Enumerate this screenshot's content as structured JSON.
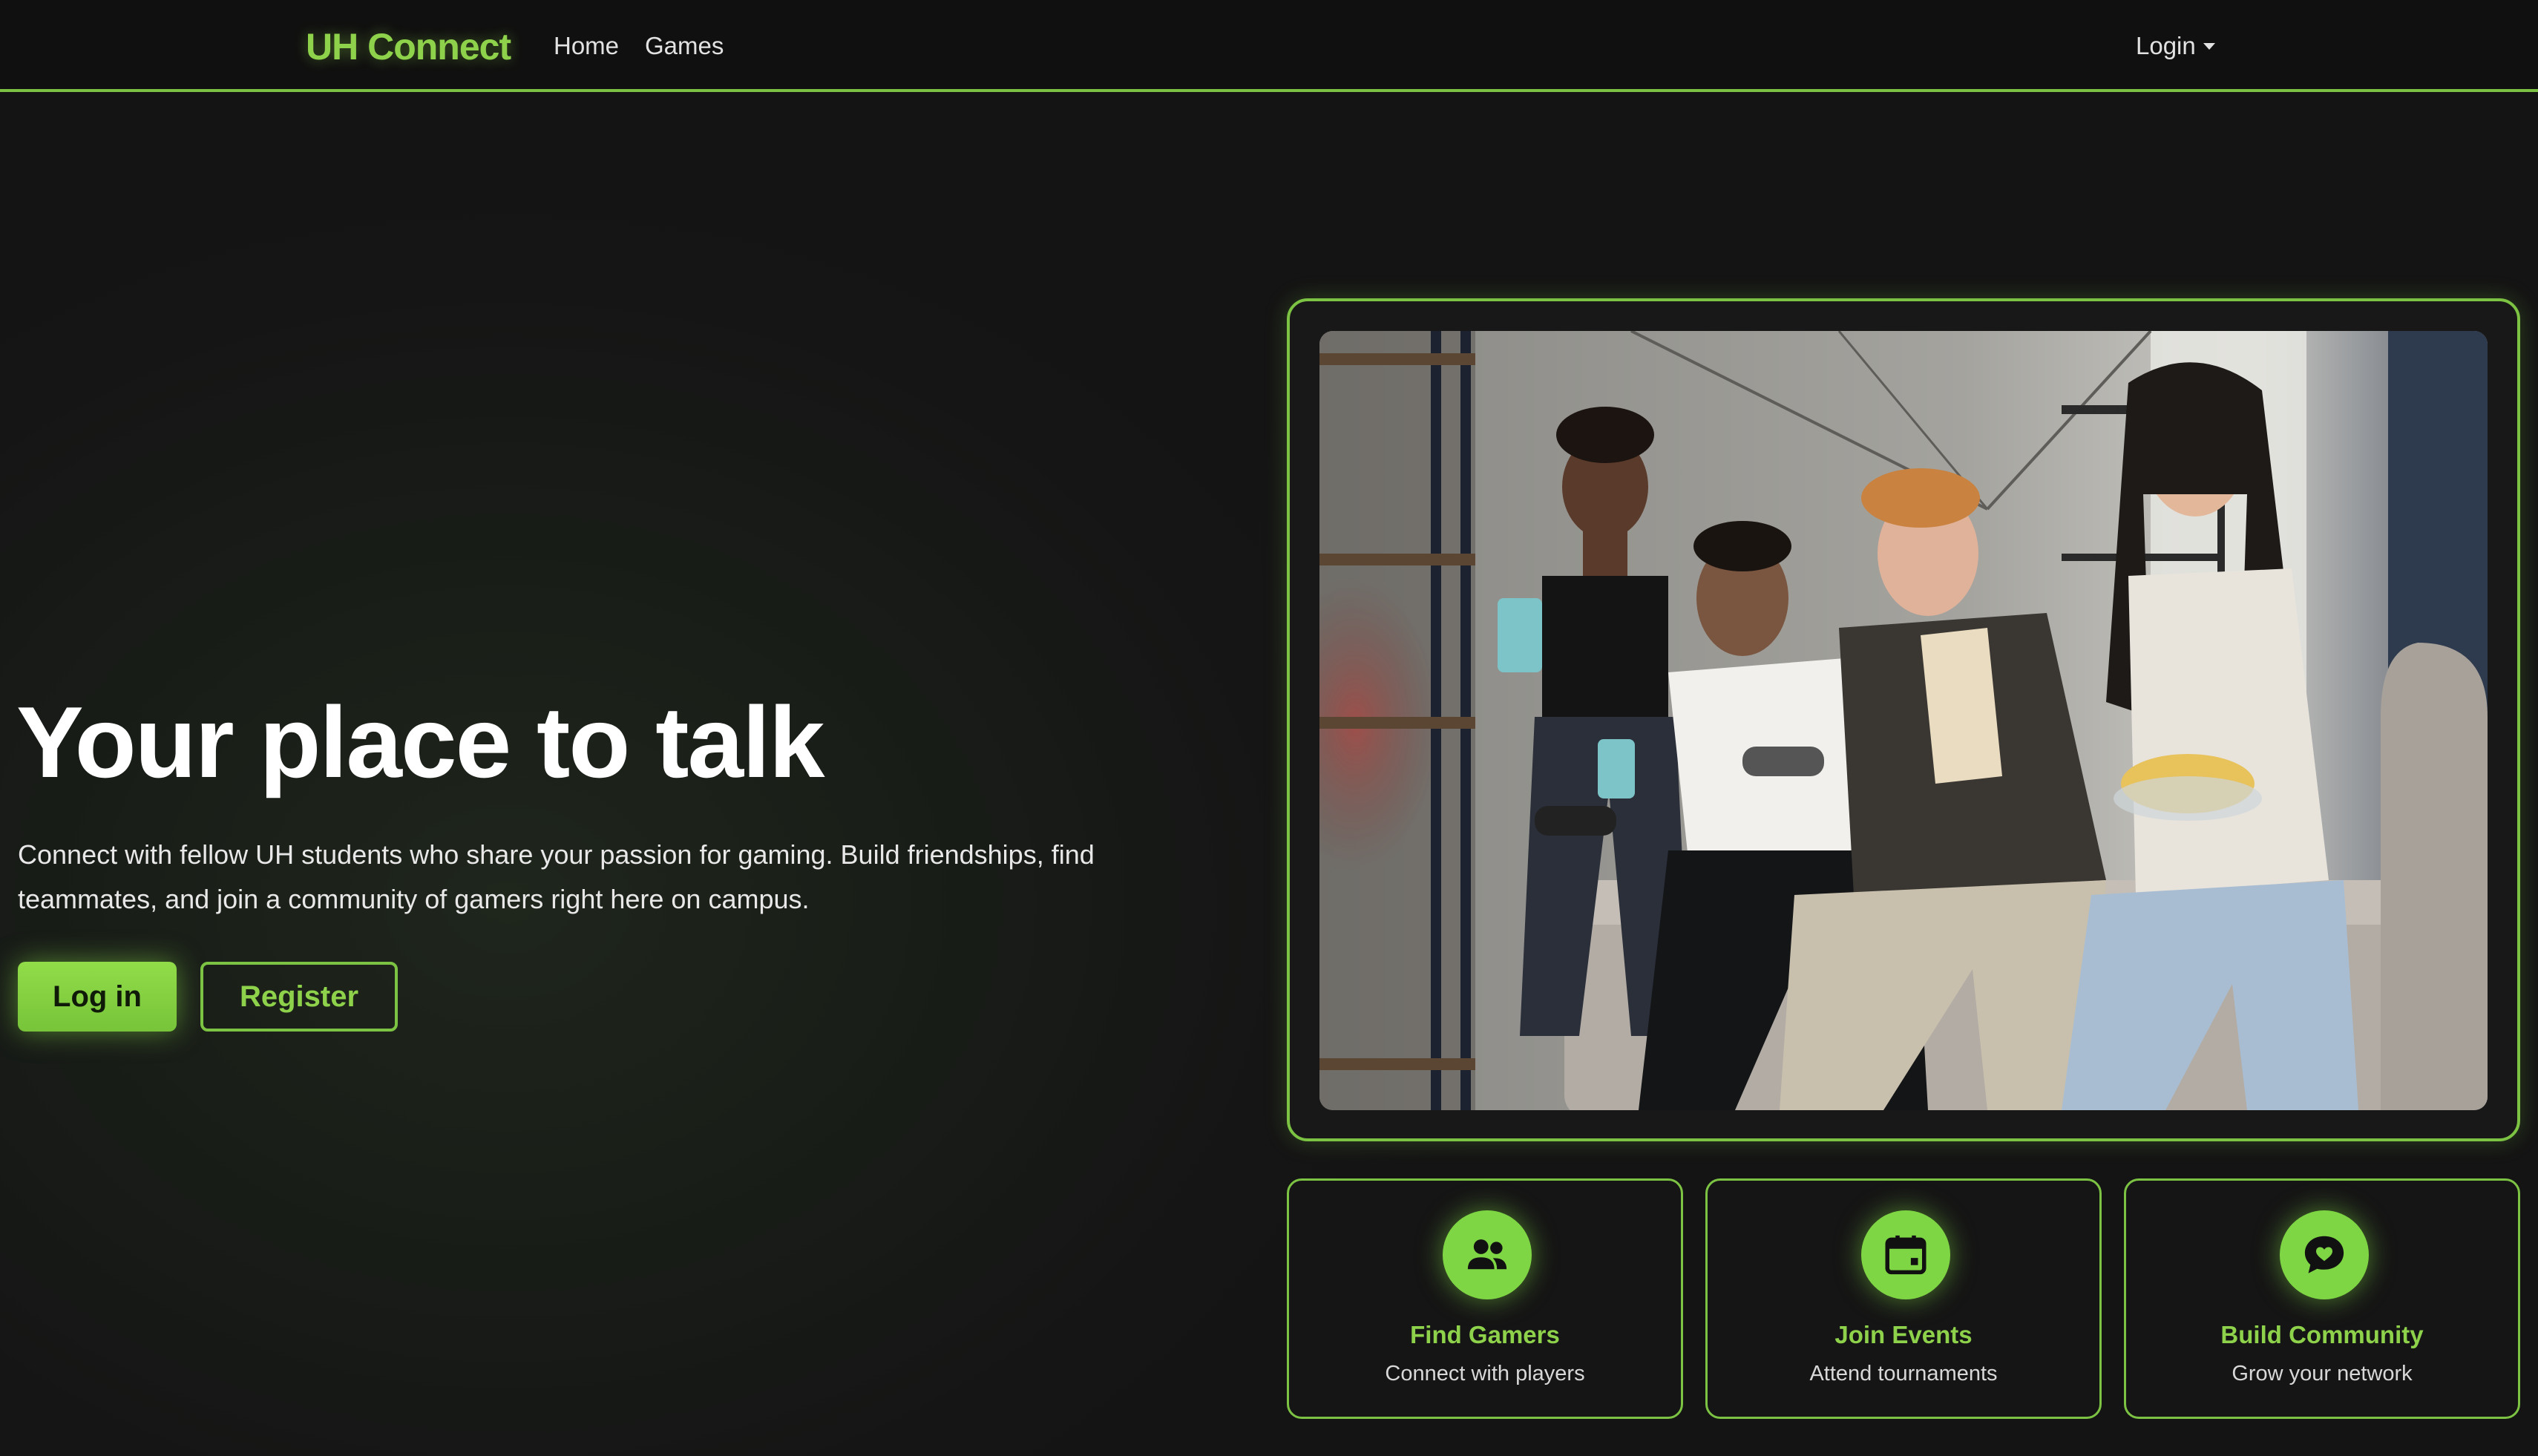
{
  "nav": {
    "brand": "UH Connect",
    "links": [
      "Home",
      "Games"
    ],
    "login_label": "Login"
  },
  "hero": {
    "title": "Your place to talk",
    "description": "Connect with fellow UH students who share your passion for gaming. Build friendships, find teammates, and join a community of gamers right here on campus.",
    "login_button": "Log in",
    "register_button": "Register"
  },
  "features": [
    {
      "icon": "users-icon",
      "title": "Find Gamers",
      "subtitle": "Connect with players"
    },
    {
      "icon": "calendar-icon",
      "title": "Join Events",
      "subtitle": "Attend tournaments"
    },
    {
      "icon": "chat-heart-icon",
      "title": "Build Community",
      "subtitle": "Grow your network"
    }
  ],
  "colors": {
    "accent": "#7cc243",
    "accent_bright": "#8ed14a",
    "background": "#151515",
    "navbar": "#101010"
  }
}
